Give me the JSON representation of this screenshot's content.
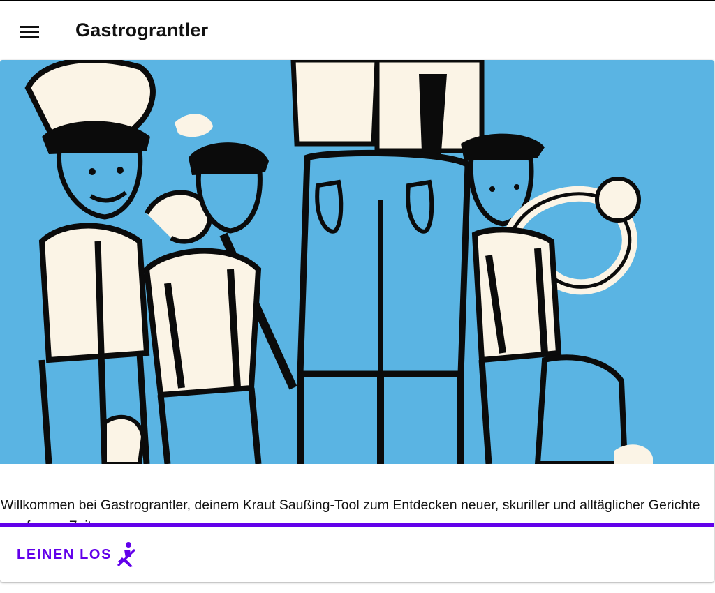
{
  "app": {
    "title": "Gastrograntler",
    "menu_icon": "menu-icon"
  },
  "card": {
    "image": "illustration-bavarian-musicians",
    "description": "Willkommen bei Gastrograntler, deinem Kraut Saußing-Tool zum Entdecken neuer, skuriller und alltäglicher Gerichte aus fernen Zeiten.",
    "action_label": "LEINEN LOS",
    "action_icon": "kayaking-icon"
  },
  "colors": {
    "accent": "#6200ea",
    "image_background": "#5ab4e3",
    "ink": "#0b0b0b",
    "cream": "#fbf4e6"
  }
}
